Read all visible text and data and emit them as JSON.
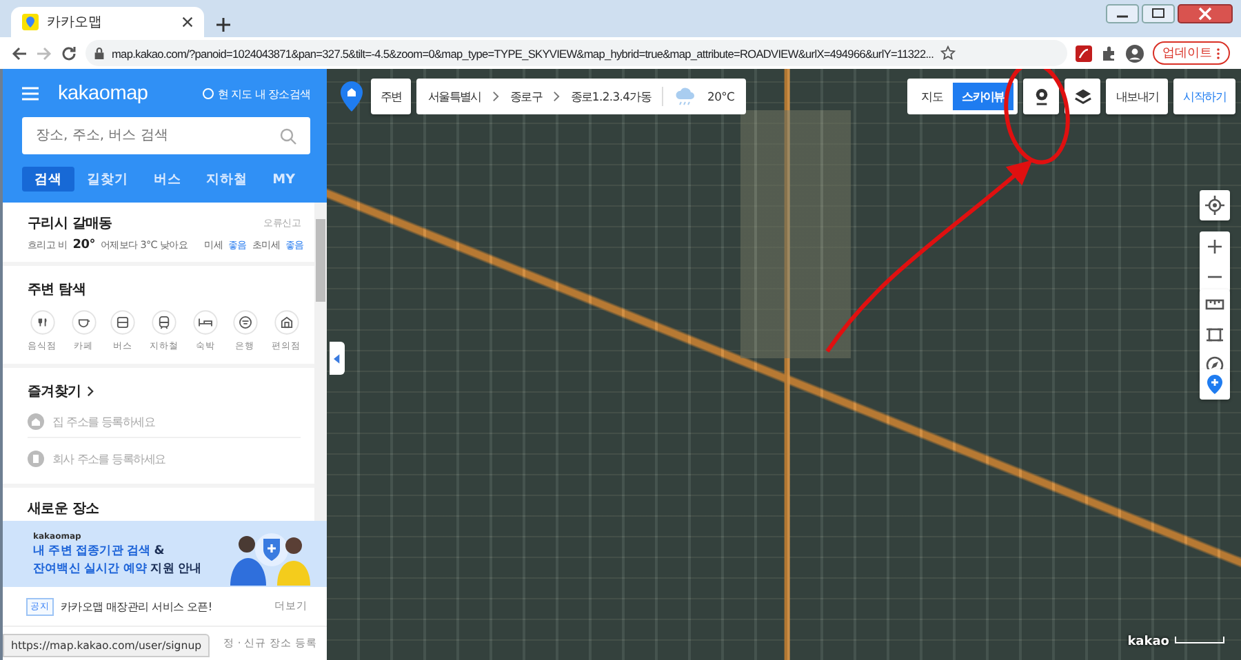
{
  "browser": {
    "tab_title": "카카오맵",
    "url": "map.kakao.com/?panoid=1024043871&pan=327.5&tilt=-4.5&zoom=0&map_type=TYPE_SKYVIEW&map_hybrid=true&map_attribute=ROADVIEW&urlX=494966&urlY=11322...",
    "update_button": "업데이트",
    "status_url": "https://map.kakao.com/user/signup"
  },
  "sidebar": {
    "logo": "kakaomap",
    "map_search_option": {
      "label": "현 지도 내 장소검색",
      "checked": false
    },
    "search": {
      "placeholder": "장소, 주소, 버스 검색"
    },
    "tabs": [
      {
        "label": "검색",
        "selected": true
      },
      {
        "label": "길찾기",
        "selected": false
      },
      {
        "label": "버스",
        "selected": false
      },
      {
        "label": "지하철",
        "selected": false
      },
      {
        "label": "MY",
        "selected": false
      }
    ],
    "weather": {
      "location": "구리시 갈매동",
      "report": "오류신고",
      "condition": "흐리고 비",
      "temperature": "20°",
      "comparison": "어제보다 3°C 낮아요",
      "dust_label": "미세",
      "dust_value": "좋음",
      "fine_dust_label": "초미세",
      "fine_dust_value": "좋음"
    },
    "nearby": {
      "title": "주변 탐색",
      "categories": [
        "음식점",
        "카페",
        "버스",
        "지하철",
        "숙박",
        "은행",
        "편의점"
      ]
    },
    "favorites": {
      "title": "즐겨찾기",
      "items": [
        "집 주소를 등록하세요",
        "회사 주소를 등록하세요"
      ]
    },
    "new_places": {
      "title": "새로운 장소"
    },
    "banner": {
      "brand": "kakaomap",
      "lines": [
        "**내 주변 접종기관 검색** &",
        "**잔여백신 실시간 예약** 지원 안내"
      ]
    },
    "notice": {
      "badge": "공지",
      "text": "카카오맵 매장관리 서비스 오픈!",
      "more": "더보기"
    },
    "footer": "정 · 신규 장소 등록"
  },
  "map": {
    "nearby_button": "주변",
    "breadcrumb": [
      "서울특별시",
      "종로구",
      "종로1.2.3.4가동"
    ],
    "temperature": "20°C",
    "map_types": [
      {
        "label": "지도",
        "selected": false
      },
      {
        "label": "스카이뷰",
        "selected": true
      }
    ],
    "export_button": "내보내기",
    "start_button": "시작하기",
    "logo": "kakao"
  }
}
